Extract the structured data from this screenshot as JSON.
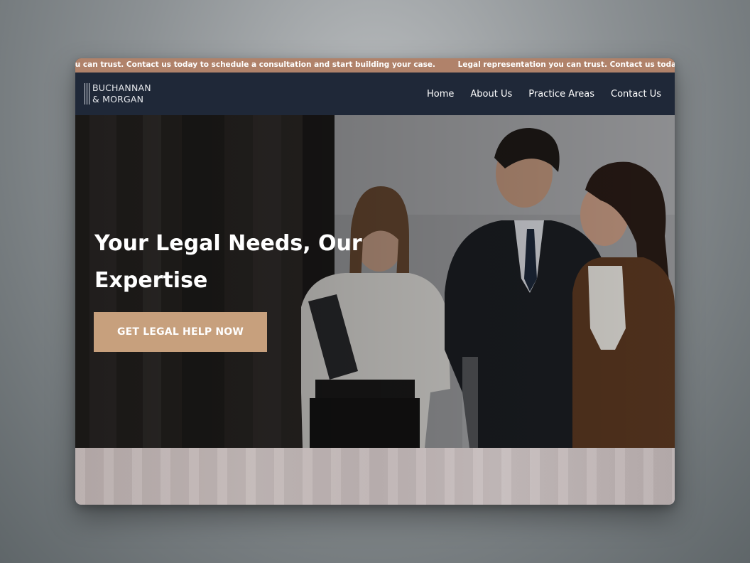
{
  "ticker": {
    "message_1": "Legal representation you can trust. Contact us today to schedule a consultation and start building your case.",
    "message_2": "Legal representation you can trust. Contact us today to schedule a consultation and start building your case."
  },
  "brand": {
    "line1": "BUCHANNAN",
    "line2": "& MORGAN"
  },
  "nav": {
    "items": [
      {
        "label": "Home"
      },
      {
        "label": "About Us"
      },
      {
        "label": "Practice Areas"
      },
      {
        "label": "Contact Us"
      }
    ]
  },
  "hero": {
    "title_line1": "Your Legal Needs, Our",
    "title_line2": "Expertise",
    "cta_label": "GET LEGAL HELP NOW",
    "image_subject": "team-photo"
  },
  "colors": {
    "ticker_bg": "#b0826a",
    "navbar_bg": "#1f2838",
    "cta_bg": "#c7a07d",
    "text_light": "#ffffff"
  }
}
